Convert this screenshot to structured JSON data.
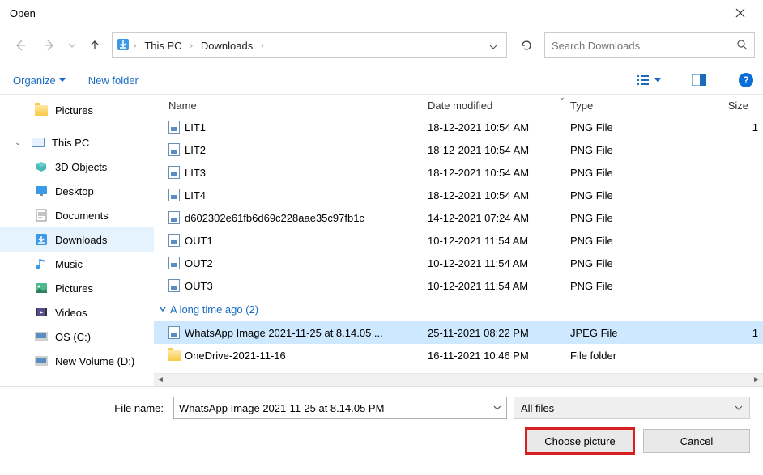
{
  "title": "Open",
  "breadcrumbs": [
    "This PC",
    "Downloads"
  ],
  "search_placeholder": "Search Downloads",
  "toolbar": {
    "organize": "Organize",
    "newfolder": "New folder"
  },
  "sidebar": [
    {
      "label": "Pictures",
      "indent": 1,
      "icon": "folder",
      "selected": false
    },
    {
      "label": "This PC",
      "indent": 0,
      "icon": "pc",
      "exp": "⌄",
      "selected": false,
      "spacer": true
    },
    {
      "label": "3D Objects",
      "indent": 1,
      "icon": "3d",
      "selected": false
    },
    {
      "label": "Desktop",
      "indent": 1,
      "icon": "desktop",
      "selected": false
    },
    {
      "label": "Documents",
      "indent": 1,
      "icon": "docs",
      "selected": false
    },
    {
      "label": "Downloads",
      "indent": 1,
      "icon": "downloads",
      "selected": true
    },
    {
      "label": "Music",
      "indent": 1,
      "icon": "music",
      "selected": false
    },
    {
      "label": "Pictures",
      "indent": 1,
      "icon": "pictures",
      "selected": false
    },
    {
      "label": "Videos",
      "indent": 1,
      "icon": "videos",
      "selected": false
    },
    {
      "label": "OS (C:)",
      "indent": 1,
      "icon": "disk",
      "selected": false
    },
    {
      "label": "New Volume (D:)",
      "indent": 1,
      "icon": "disk",
      "selected": false
    }
  ],
  "columns": {
    "name": "Name",
    "date": "Date modified",
    "type": "Type",
    "size": "Size"
  },
  "files": [
    {
      "name": "LIT1",
      "date": "18-12-2021 10:54 AM",
      "type": "PNG File",
      "size": "1",
      "icon": "img",
      "selected": false
    },
    {
      "name": "LIT2",
      "date": "18-12-2021 10:54 AM",
      "type": "PNG File",
      "size": "",
      "icon": "img",
      "selected": false
    },
    {
      "name": "LIT3",
      "date": "18-12-2021 10:54 AM",
      "type": "PNG File",
      "size": "",
      "icon": "img",
      "selected": false
    },
    {
      "name": "LIT4",
      "date": "18-12-2021 10:54 AM",
      "type": "PNG File",
      "size": "",
      "icon": "img",
      "selected": false
    },
    {
      "name": "d602302e61fb6d69c228aae35c97fb1c",
      "date": "14-12-2021 07:24 AM",
      "type": "PNG File",
      "size": "",
      "icon": "img",
      "selected": false
    },
    {
      "name": "OUT1",
      "date": "10-12-2021 11:54 AM",
      "type": "PNG File",
      "size": "",
      "icon": "img",
      "selected": false
    },
    {
      "name": "OUT2",
      "date": "10-12-2021 11:54 AM",
      "type": "PNG File",
      "size": "",
      "icon": "img",
      "selected": false
    },
    {
      "name": "OUT3",
      "date": "10-12-2021 11:54 AM",
      "type": "PNG File",
      "size": "",
      "icon": "img",
      "selected": false
    }
  ],
  "group_label": "A long time ago (2)",
  "old_files": [
    {
      "name": "WhatsApp Image 2021-11-25 at 8.14.05 ...",
      "date": "25-11-2021 08:22 PM",
      "type": "JPEG File",
      "size": "1",
      "icon": "img",
      "selected": true
    },
    {
      "name": "OneDrive-2021-11-16",
      "date": "16-11-2021 10:46 PM",
      "type": "File folder",
      "size": "",
      "icon": "folder",
      "selected": false
    }
  ],
  "footer": {
    "filename_label": "File name:",
    "filename_value": "WhatsApp Image 2021-11-25 at 8.14.05 PM",
    "filetype": "All files",
    "choose": "Choose picture",
    "cancel": "Cancel"
  }
}
